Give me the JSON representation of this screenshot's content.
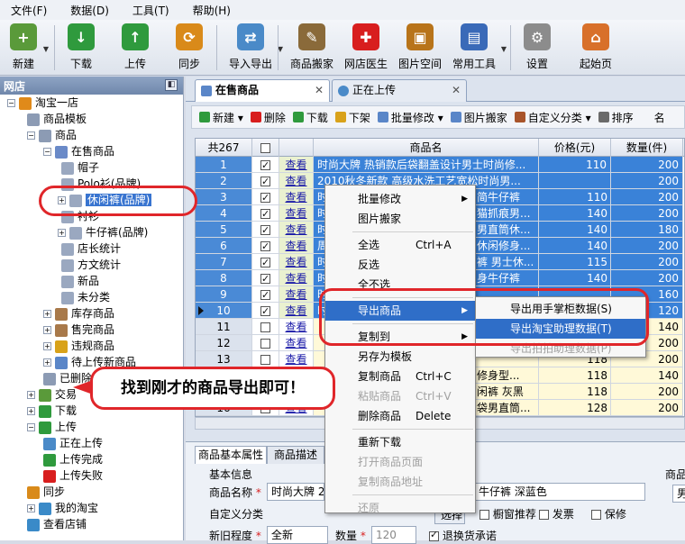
{
  "menubar": [
    "文件(F)",
    "数据(D)",
    "工具(T)",
    "帮助(H)"
  ],
  "toolbar": [
    {
      "label": "新建",
      "color": "#5a9a3a",
      "glyph": "+",
      "dd": true
    },
    {
      "label": "下载",
      "color": "#2f9a3d",
      "glyph": "↓"
    },
    {
      "label": "上传",
      "color": "#2f9a3d",
      "glyph": "↑"
    },
    {
      "label": "同步",
      "color": "#d98a1a",
      "glyph": "⟳"
    },
    {
      "label": "导入导出",
      "color": "#4a8ac8",
      "glyph": "⇄",
      "dd": true
    },
    {
      "label": "商品搬家",
      "color": "#8a6a3a",
      "glyph": "✎"
    },
    {
      "label": "网店医生",
      "color": "#d81e1e",
      "glyph": "✚"
    },
    {
      "label": "图片空间",
      "color": "#b8741a",
      "glyph": "▣"
    },
    {
      "label": "常用工具",
      "color": "#3a6ab8",
      "glyph": "▤",
      "dd": true
    },
    {
      "label": "设置",
      "color": "#8c8c8c",
      "glyph": "⚙"
    },
    {
      "label": "起始页",
      "color": "#d8702a",
      "glyph": "⌂"
    }
  ],
  "left_panel": {
    "title": "网店",
    "pin": "◧"
  },
  "tree": [
    {
      "label": "淘宝一店",
      "ex": "−",
      "icon": "#e08a1a"
    },
    {
      "label": "商品模板",
      "ex": "",
      "icon": "#8c9bb4"
    },
    {
      "label": "商品",
      "ex": "−",
      "icon": "#8c9bb4"
    },
    {
      "label": "在售商品",
      "ex": "−",
      "icon": "#6a8ac8"
    },
    {
      "label": "帽子",
      "ex": "",
      "icon": "#9aa8c0"
    },
    {
      "label": "Polo衫(品牌)",
      "ex": "",
      "icon": "#9aa8c0"
    },
    {
      "label": "休闲裤(品牌)",
      "ex": "+",
      "icon": "#9aa8c0",
      "selected": true
    },
    {
      "label": "衬衫",
      "ex": "",
      "icon": "#9aa8c0"
    },
    {
      "label": "牛仔裤(品牌)",
      "ex": "+",
      "icon": "#9aa8c0"
    },
    {
      "label": "店长统计",
      "ex": "",
      "icon": "#9aa8c0"
    },
    {
      "label": "方文统计",
      "ex": "",
      "icon": "#9aa8c0"
    },
    {
      "label": "新品",
      "ex": "",
      "icon": "#9aa8c0"
    },
    {
      "label": "未分类",
      "ex": "",
      "icon": "#9aa8c0"
    },
    {
      "label": "库存商品",
      "ex": "+",
      "icon": "#a8794a"
    },
    {
      "label": "售完商品",
      "ex": "+",
      "icon": "#a8794a"
    },
    {
      "label": "违规商品",
      "ex": "+",
      "icon": "#d8a21a"
    },
    {
      "label": "待上传新商品",
      "ex": "+",
      "icon": "#5a86c8"
    },
    {
      "label": "已删除商品",
      "ex": "",
      "icon": "#8c9bb4"
    },
    {
      "label": "交易",
      "ex": "+",
      "icon": "#5a9a3a"
    },
    {
      "label": "下载",
      "ex": "+",
      "icon": "#2f9a3d"
    },
    {
      "label": "上传",
      "ex": "−",
      "icon": "#2f9a3d"
    },
    {
      "label": "正在上传",
      "ex": "",
      "icon": "#4a8ac8"
    },
    {
      "label": "上传完成",
      "ex": "",
      "icon": "#2f9a3d"
    },
    {
      "label": "上传失败",
      "ex": "",
      "icon": "#d81e1e"
    },
    {
      "label": "同步",
      "ex": "",
      "icon": "#d98a1a"
    },
    {
      "label": "我的淘宝",
      "ex": "+",
      "icon": "#3a8ac8"
    },
    {
      "label": "查看店铺",
      "ex": "",
      "icon": "#3a8ac8"
    }
  ],
  "tabs": [
    {
      "label": "在售商品",
      "close": "✕"
    },
    {
      "label": "正在上传",
      "close": "✕"
    }
  ],
  "subtoolbar": [
    {
      "label": "新建 ▾",
      "color": "#2f9a3d"
    },
    {
      "label": "删除",
      "color": "#d81e1e"
    },
    {
      "label": "下载",
      "color": "#2f9a3d"
    },
    {
      "label": "下架",
      "color": "#d9a21a"
    },
    {
      "label": "批量修改 ▾",
      "color": "#5a86c8"
    },
    {
      "label": "图片搬家",
      "color": "#5a86c8"
    },
    {
      "label": "自定义分类 ▾",
      "color": "#a8542a"
    },
    {
      "label": "排序",
      "color": "#6a6a6a"
    },
    {
      "label": "名",
      "color": "transparent"
    }
  ],
  "grid": {
    "headers": [
      "共267",
      "",
      "",
      "商品名",
      "价格(元)",
      "数量(件)"
    ],
    "link_text": "查看",
    "rows": [
      {
        "n": "1",
        "name": "时尚大牌 热销款后袋翻盖设计男士时尚修...",
        "price": "110",
        "qty": "200",
        "sel": true
      },
      {
        "n": "2",
        "name": "2010秋冬新款 高级水洗工艺宽松时尚男...",
        "price": "",
        "qty": "200",
        "sel": true
      },
      {
        "n": "3",
        "name": "时",
        "price": "",
        "qty": "200",
        "sel": true
      },
      {
        "n": "4",
        "name": "时",
        "price": "",
        "qty": "200",
        "sel": true
      },
      {
        "n": "5",
        "name": "时",
        "price": "",
        "qty": "180",
        "sel": true
      },
      {
        "n": "6",
        "name": "周",
        "price": "",
        "qty": "200",
        "sel": true
      },
      {
        "n": "7",
        "name": "时",
        "price": "",
        "qty": "200",
        "sel": true
      },
      {
        "n": "8",
        "name": "时",
        "price": "",
        "qty": "200",
        "sel": true
      },
      {
        "n": "9",
        "name": "时",
        "price": "",
        "qty": "160",
        "sel": true
      },
      {
        "n": "10",
        "name": "时",
        "price": "",
        "qty": "120",
        "sel": true
      },
      {
        "n": "11",
        "name": "",
        "price": "",
        "qty": "140",
        "sel": false
      },
      {
        "n": "12",
        "name": "",
        "price": "",
        "qty": "200",
        "sel": false
      },
      {
        "n": "13",
        "name": "",
        "price": "",
        "qty": "200",
        "sel": false
      },
      {
        "n": "14",
        "name": "",
        "price": "",
        "qty": "140",
        "sel": false
      },
      {
        "n": "15",
        "name": "",
        "price": "",
        "qty": "200",
        "sel": false
      },
      {
        "n": "16",
        "name": "",
        "price": "",
        "qty": "200",
        "sel": false
      }
    ],
    "overlay_text": [
      {
        "row": 3,
        "text": "简牛仔裤",
        "price": "110"
      },
      {
        "row": 4,
        "text": "猫抓痕男...",
        "price": "140"
      },
      {
        "row": 5,
        "text": "男直筒休...",
        "price": "140"
      },
      {
        "row": 6,
        "text": "休闲修身...",
        "price": "140"
      },
      {
        "row": 7,
        "text": "裤 男士休...",
        "price": "115"
      },
      {
        "row": 8,
        "text": "身牛仔裤",
        "price": "140"
      },
      {
        "row": 11,
        "text": "",
        "price": "140"
      },
      {
        "row": 12,
        "text": "",
        "price": "140"
      },
      {
        "row": 13,
        "text": "",
        "price": "118"
      },
      {
        "row": 14,
        "text": "修身型...",
        "price": "118"
      },
      {
        "row": 15,
        "text": "闲裤 灰黑",
        "price": "118"
      },
      {
        "row": 16,
        "text": "袋男直筒...",
        "price": "128"
      }
    ]
  },
  "context_menu": [
    {
      "label": "批量修改",
      "sc": "",
      "arrow": "▶"
    },
    {
      "label": "图片搬家",
      "sc": ""
    },
    {
      "sep": true
    },
    {
      "label": "全选",
      "sc": "Ctrl+A"
    },
    {
      "label": "反选",
      "sc": ""
    },
    {
      "label": "全不选",
      "sc": ""
    },
    {
      "sep": true
    },
    {
      "label": "导出商品",
      "sc": "",
      "arrow": "▶",
      "hl": true
    },
    {
      "sep": true
    },
    {
      "label": "复制到",
      "sc": "",
      "arrow": "▶"
    },
    {
      "label": "另存为模板",
      "sc": ""
    },
    {
      "label": "复制商品",
      "sc": "Ctrl+C"
    },
    {
      "label": "粘贴商品",
      "sc": "Ctrl+V",
      "dis": true
    },
    {
      "label": "删除商品",
      "sc": "Delete"
    },
    {
      "sep": true
    },
    {
      "label": "重新下载",
      "sc": ""
    },
    {
      "label": "打开商品页面",
      "sc": "",
      "dis": true
    },
    {
      "label": "复制商品地址",
      "sc": "",
      "dis": true
    },
    {
      "sep": true
    },
    {
      "label": "还原",
      "sc": "",
      "dis": true
    }
  ],
  "submenu": [
    {
      "label": "导出用手掌柜数据(S)"
    },
    {
      "label": "导出淘宝助理数据(T)",
      "hl": true
    },
    {
      "label": "导出拍拍助理数据(P)",
      "dis": true
    }
  ],
  "callout": "找到刚才的商品导出即可！",
  "bottom": {
    "tabs": [
      "商品基本属性",
      "商品描述"
    ],
    "section": "基本信息",
    "name_label": "商品名称",
    "name_value": "时尚大牌 20",
    "name_value_right": "牛仔裤 深蓝色",
    "custom_label": "自定义分类",
    "select_btn": "选择",
    "new_label": "新旧程度",
    "new_value": "全新",
    "qty_label": "数量",
    "qty_value": "120",
    "check1": "橱窗推荐",
    "check2": "发票",
    "check3": "保修",
    "check4": "退换货承诺",
    "right_tab": "商品",
    "right_val": "男"
  }
}
